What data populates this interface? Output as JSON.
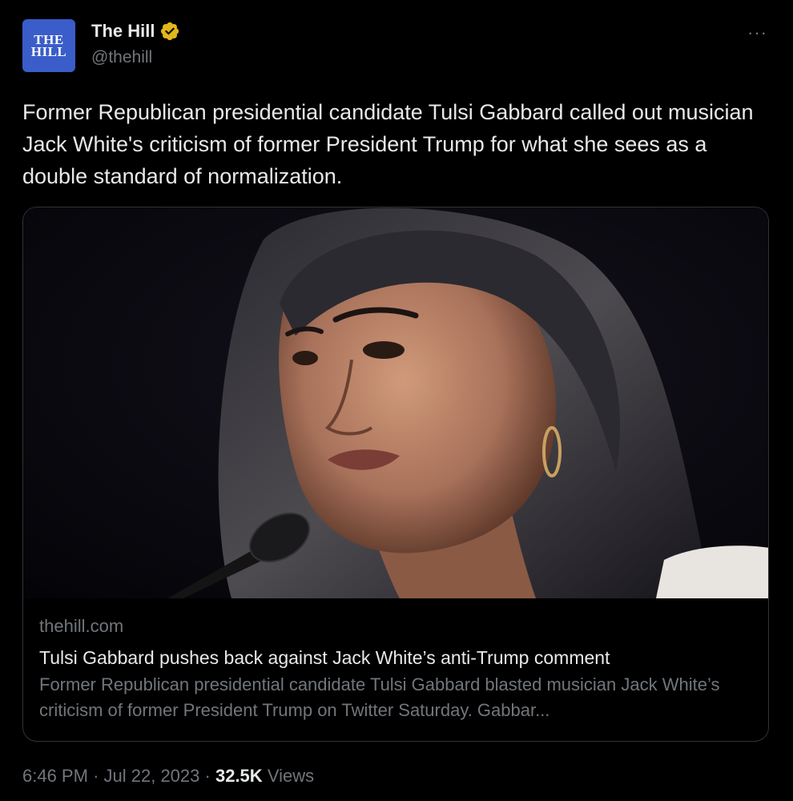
{
  "account": {
    "avatar_line1": "THE",
    "avatar_line2": "HILL",
    "display_name": "The Hill",
    "handle": "@thehill",
    "verified_icon": "gold-check-badge",
    "verified_color": "#e2b719"
  },
  "menu": {
    "more_label": "···"
  },
  "tweet": {
    "text": "Former Republican presidential candidate Tulsi Gabbard called out musician Jack White's criticism of former President Trump for what she sees as a double standard of normalization."
  },
  "card": {
    "image_icon": "photo-portrait-with-microphone",
    "domain": "thehill.com",
    "title": "Tulsi Gabbard pushes back against Jack White’s anti-Trump comment",
    "description": "Former Republican presidential candidate Tulsi Gabbard blasted musician Jack White’s criticism of former President Trump on Twitter Saturday. Gabbar..."
  },
  "meta": {
    "time": "6:46 PM",
    "separator": "·",
    "date": "Jul 22, 2023",
    "views_count": "32.5K",
    "views_label": "Views"
  },
  "colors": {
    "background": "#000000",
    "text_primary": "#e7e9ea",
    "text_secondary": "#71767b",
    "avatar_bg": "#3b5dc9",
    "border": "#2f3336"
  }
}
